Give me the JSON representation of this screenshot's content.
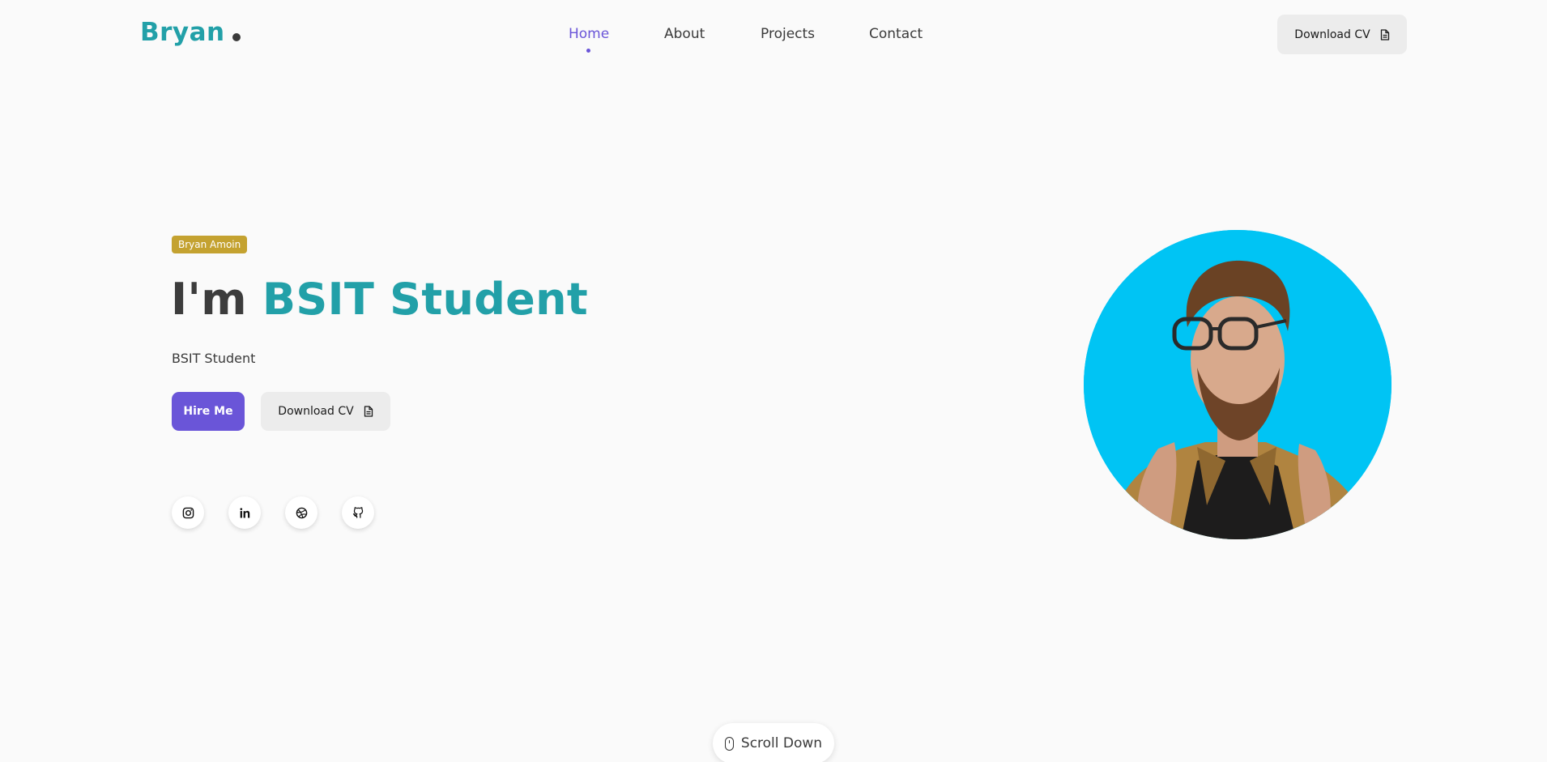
{
  "brand": {
    "name": "Bryan"
  },
  "nav": {
    "items": [
      {
        "label": "Home",
        "active": true
      },
      {
        "label": "About",
        "active": false
      },
      {
        "label": "Projects",
        "active": false
      },
      {
        "label": "Contact",
        "active": false
      }
    ]
  },
  "header": {
    "cv_label": "Download CV"
  },
  "hero": {
    "badge": "Bryan Amoin",
    "title_prefix": "I'm",
    "title_accent": "BSIT Student",
    "subtitle": "BSIT Student",
    "hire_label": "Hire Me",
    "cv_label": "Download CV"
  },
  "socials": [
    {
      "icon": "instagram-icon"
    },
    {
      "icon": "linkedin-icon"
    },
    {
      "icon": "dribbble-icon"
    },
    {
      "icon": "github-icon"
    }
  ],
  "scroll": {
    "label": "Scroll Down"
  },
  "colors": {
    "accent_teal": "#22a0a8",
    "accent_purple": "#6a55d8",
    "badge_gold": "#c4a230",
    "portrait_bg": "#00c4f4",
    "page_bg": "#fafafa"
  }
}
